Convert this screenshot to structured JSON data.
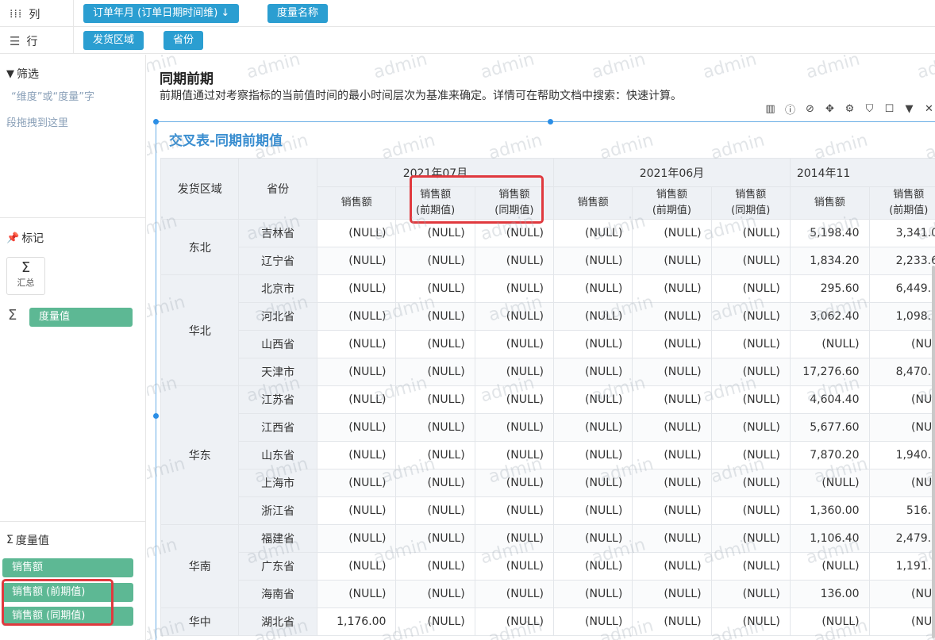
{
  "shelves": {
    "columns": {
      "label": "列",
      "pills": [
        "订单年月 (订单日期时间维) ↓",
        "度量名称"
      ]
    },
    "rows": {
      "label": "行",
      "pills": [
        "发货区域",
        "省份"
      ]
    }
  },
  "left": {
    "filter_title": "筛选",
    "filter_hint_1": "“维度”或“度量”字",
    "filter_hint_2": "段拖拽到这里",
    "marks_title": "标记",
    "sum_label": "汇总",
    "measure_value_pill": "度量值",
    "measures_title": "度量值",
    "measures": [
      "销售额",
      "销售额 (前期值)",
      "销售额 (同期值)"
    ]
  },
  "main": {
    "title": "同期前期",
    "desc": "前期值通过对考察指标的当前值时间的最小时间层次为基准来确定。详情可在帮助文档中搜索：快速计算。",
    "widget_title": "交叉表-同期前期值",
    "watermark": "admin"
  },
  "table": {
    "dim_headers": [
      "发货区域",
      "省份"
    ],
    "periods": [
      "2021年07月",
      "2021年06月",
      "2014年11"
    ],
    "measure_headers": [
      [
        "销售额",
        "",
        ""
      ],
      [
        "销售额",
        "(前期值)",
        ""
      ],
      [
        "销售额",
        "(同期值)",
        ""
      ]
    ],
    "labels": {
      "sales": "销售额",
      "prev_1": "销售额",
      "prev_2": "(前期值)",
      "same_1": "销售额",
      "same_2": "(同期值)"
    },
    "regions": [
      {
        "name": "东北",
        "rows": [
          {
            "province": "吉林省",
            "vals": [
              "(NULL)",
              "(NULL)",
              "(NULL)",
              "(NULL)",
              "(NULL)",
              "(NULL)",
              "5,198.40",
              "3,341.0"
            ]
          },
          {
            "province": "辽宁省",
            "vals": [
              "(NULL)",
              "(NULL)",
              "(NULL)",
              "(NULL)",
              "(NULL)",
              "(NULL)",
              "1,834.20",
              "2,233.6"
            ]
          }
        ]
      },
      {
        "name": "华北",
        "rows": [
          {
            "province": "北京市",
            "vals": [
              "(NULL)",
              "(NULL)",
              "(NULL)",
              "(NULL)",
              "(NULL)",
              "(NULL)",
              "295.60",
              "6,449.0"
            ]
          },
          {
            "province": "河北省",
            "vals": [
              "(NULL)",
              "(NULL)",
              "(NULL)",
              "(NULL)",
              "(NULL)",
              "(NULL)",
              "3,062.40",
              "1,098.9"
            ]
          },
          {
            "province": "山西省",
            "vals": [
              "(NULL)",
              "(NULL)",
              "(NULL)",
              "(NULL)",
              "(NULL)",
              "(NULL)",
              "(NULL)",
              "(NUL"
            ]
          },
          {
            "province": "天津市",
            "vals": [
              "(NULL)",
              "(NULL)",
              "(NULL)",
              "(NULL)",
              "(NULL)",
              "(NULL)",
              "17,276.60",
              "8,470.2"
            ]
          }
        ]
      },
      {
        "name": "华东",
        "rows": [
          {
            "province": "江苏省",
            "vals": [
              "(NULL)",
              "(NULL)",
              "(NULL)",
              "(NULL)",
              "(NULL)",
              "(NULL)",
              "4,604.40",
              "(NUL"
            ]
          },
          {
            "province": "江西省",
            "vals": [
              "(NULL)",
              "(NULL)",
              "(NULL)",
              "(NULL)",
              "(NULL)",
              "(NULL)",
              "5,677.60",
              "(NUL"
            ]
          },
          {
            "province": "山东省",
            "vals": [
              "(NULL)",
              "(NULL)",
              "(NULL)",
              "(NULL)",
              "(NULL)",
              "(NULL)",
              "7,870.20",
              "1,940.0"
            ]
          },
          {
            "province": "上海市",
            "vals": [
              "(NULL)",
              "(NULL)",
              "(NULL)",
              "(NULL)",
              "(NULL)",
              "(NULL)",
              "(NULL)",
              "(NUL"
            ]
          },
          {
            "province": "浙江省",
            "vals": [
              "(NULL)",
              "(NULL)",
              "(NULL)",
              "(NULL)",
              "(NULL)",
              "(NULL)",
              "1,360.00",
              "516.0"
            ]
          }
        ]
      },
      {
        "name": "华南",
        "rows": [
          {
            "province": "福建省",
            "vals": [
              "(NULL)",
              "(NULL)",
              "(NULL)",
              "(NULL)",
              "(NULL)",
              "(NULL)",
              "1,106.40",
              "2,479.0"
            ]
          },
          {
            "province": "广东省",
            "vals": [
              "(NULL)",
              "(NULL)",
              "(NULL)",
              "(NULL)",
              "(NULL)",
              "(NULL)",
              "(NULL)",
              "1,191.2"
            ]
          },
          {
            "province": "海南省",
            "vals": [
              "(NULL)",
              "(NULL)",
              "(NULL)",
              "(NULL)",
              "(NULL)",
              "(NULL)",
              "136.00",
              "(NUL"
            ]
          }
        ]
      },
      {
        "name": "华中",
        "rows": [
          {
            "province": "湖北省",
            "vals": [
              "1,176.00",
              "(NULL)",
              "(NULL)",
              "(NULL)",
              "(NULL)",
              "(NULL)",
              "(NULL)",
              "(NUL"
            ]
          }
        ]
      }
    ]
  },
  "colors": {
    "accent": "#2b9ed1",
    "measure_pill": "#5db894",
    "highlight": "#e0393e",
    "header_bg": "#eef1f5"
  }
}
